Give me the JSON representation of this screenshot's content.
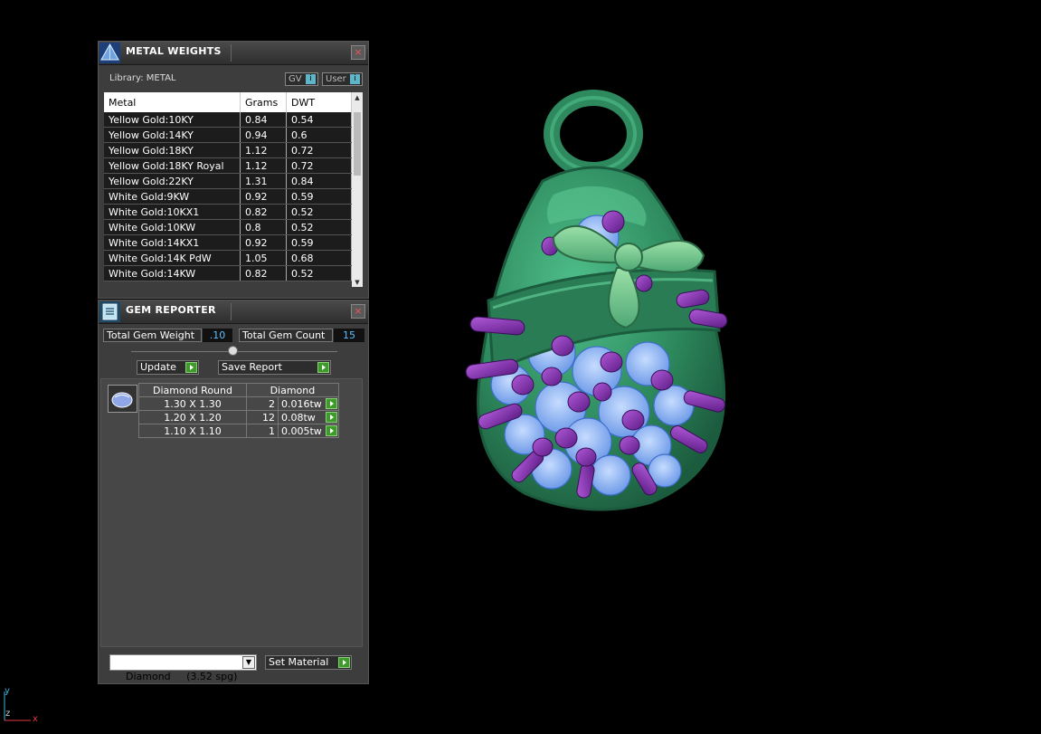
{
  "metal_weights": {
    "title": "METAL WEIGHTS",
    "library_label": "Library: METAL",
    "toggle_gv": "GV",
    "toggle_user": "User",
    "columns": [
      "Metal",
      "Grams",
      "DWT"
    ],
    "rows": [
      {
        "metal": "Yellow Gold:10KY",
        "grams": "0.84",
        "dwt": "0.54"
      },
      {
        "metal": "Yellow Gold:14KY",
        "grams": "0.94",
        "dwt": "0.6"
      },
      {
        "metal": "Yellow Gold:18KY",
        "grams": "1.12",
        "dwt": "0.72"
      },
      {
        "metal": "Yellow Gold:18KY Royal",
        "grams": "1.12",
        "dwt": "0.72"
      },
      {
        "metal": "Yellow Gold:22KY",
        "grams": "1.31",
        "dwt": "0.84"
      },
      {
        "metal": "White Gold:9KW",
        "grams": "0.92",
        "dwt": "0.59"
      },
      {
        "metal": "White Gold:10KX1",
        "grams": "0.82",
        "dwt": "0.52"
      },
      {
        "metal": "White Gold:10KW",
        "grams": "0.8",
        "dwt": "0.52"
      },
      {
        "metal": "White Gold:14KX1",
        "grams": "0.92",
        "dwt": "0.59"
      },
      {
        "metal": "White Gold:14K PdW",
        "grams": "1.05",
        "dwt": "0.68"
      },
      {
        "metal": "White Gold:14KW",
        "grams": "0.82",
        "dwt": "0.52"
      }
    ]
  },
  "gem_reporter": {
    "title": "GEM REPORTER",
    "total_weight_label": "Total Gem Weight",
    "total_weight_value": ".10",
    "total_count_label": "Total Gem Count",
    "total_count_value": "15",
    "update_label": "Update",
    "save_report_label": "Save Report",
    "gem_header_shape": "Diamond Round",
    "gem_header_material": "Diamond",
    "gem_rows": [
      {
        "size": "1.30 X 1.30",
        "count": "2",
        "weight": "0.016tw"
      },
      {
        "size": "1.20 X 1.20",
        "count": "12",
        "weight": "0.08tw"
      },
      {
        "size": "1.10 X 1.10",
        "count": "1",
        "weight": "0.005tw"
      }
    ],
    "material_select": "Diamond     (3.52 spg)",
    "set_material_label": "Set Material"
  },
  "axis": {
    "y": "y",
    "z": "z",
    "x": "x"
  },
  "colors": {
    "metal": "#2e8a5e",
    "gem": "#8fb8f5",
    "prong": "#7a2aa0",
    "accent_go": "#3e9a2a"
  }
}
